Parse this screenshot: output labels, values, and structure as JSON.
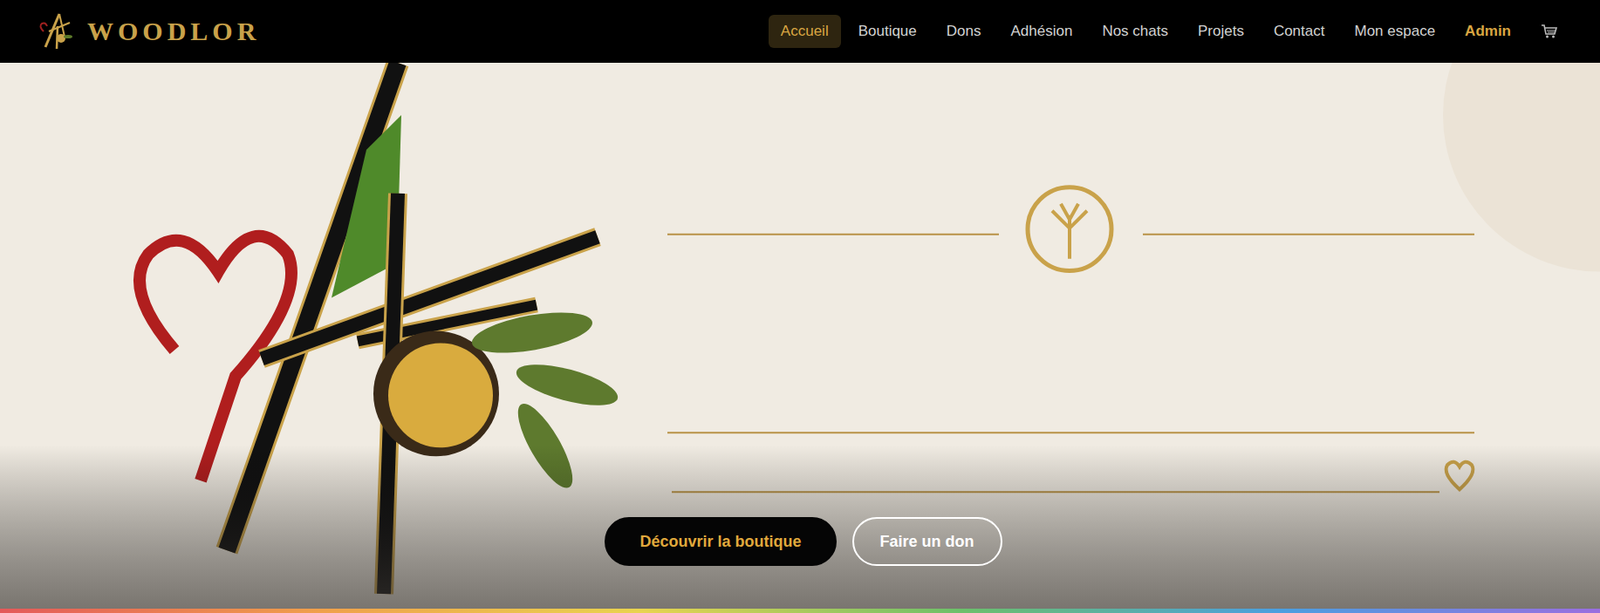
{
  "brand": {
    "name": "WOODLOR"
  },
  "nav": [
    {
      "label": "Accueil",
      "selected": true,
      "kind": "link"
    },
    {
      "label": "Boutique",
      "selected": false,
      "kind": "link"
    },
    {
      "label": "Dons",
      "selected": false,
      "kind": "link"
    },
    {
      "label": "Adhésion",
      "selected": false,
      "kind": "link"
    },
    {
      "label": "Nos chats",
      "selected": false,
      "kind": "link"
    },
    {
      "label": "Projets",
      "selected": false,
      "kind": "link"
    },
    {
      "label": "Contact",
      "selected": false,
      "kind": "link"
    },
    {
      "label": "Mon espace",
      "selected": false,
      "kind": "link"
    },
    {
      "label": "Admin",
      "selected": false,
      "kind": "admin"
    }
  ],
  "hero": {
    "buttons": [
      {
        "label": "Découvrir la boutique",
        "kind": "primary"
      },
      {
        "label": "Faire un don",
        "kind": "secondary"
      }
    ]
  }
}
